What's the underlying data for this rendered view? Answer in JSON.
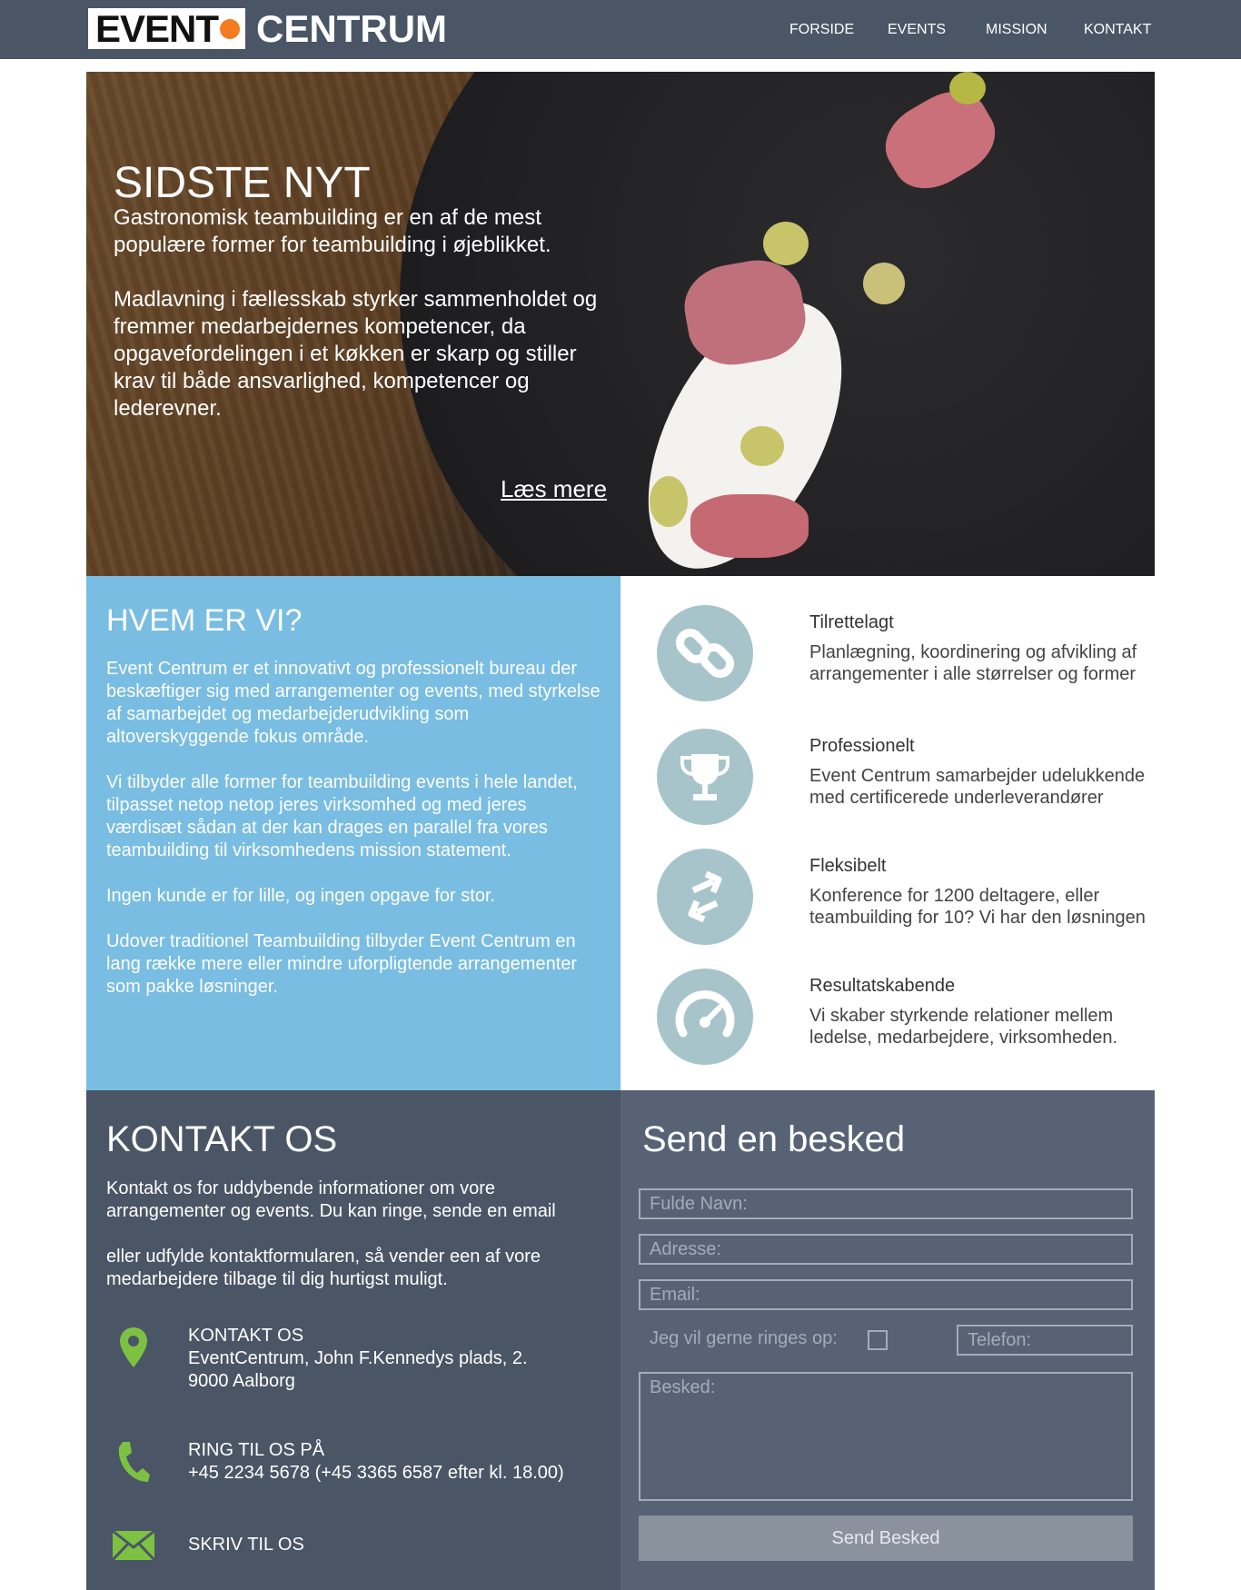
{
  "header": {
    "logo_left": "EVENT",
    "logo_right": "CENTRUM",
    "nav": [
      "FORSIDE",
      "EVENTS",
      "MISSION",
      "KONTAKT"
    ]
  },
  "hero": {
    "title": "SIDSTE NYT",
    "paragraph1": "Gastronomisk teambuilding er en af de mest populære former for teambuilding i øjeblikket.",
    "paragraph2": "Madlavning i fællesskab styrker sammenholdet og fremmer medarbejdernes kompetencer, da opgavefordelingen i et køkken er skarp og stiller krav til både ansvarlighed, kompetencer og lederevner.",
    "read_more": "Læs mere"
  },
  "who": {
    "title": "HVEM ER VI?",
    "paragraphs": [
      "Event Centrum er et innovativt og professionelt bureau der beskæftiger sig med arrangementer og events, med styrkelse af samarbejdet og medarbejderudvikling som altoverskyggende fokus område.",
      "Vi tilbyder alle former for teambuilding events i hele landet, tilpasset netop netop jeres virksomhed og med jeres værdisæt sådan at der kan drages en parallel fra vores teambuilding til virksomhedens mission statement.",
      "Ingen  kunde er for lille, og ingen opgave for stor.",
      "Udover traditionel Teambuilding tilbyder Event Centrum en lang række mere eller mindre uforpligtende arrangementer som pakke løsninger."
    ]
  },
  "features": [
    {
      "title": "Tilrettelagt",
      "text": "Planlægning, koordinering og afvikling af arrangementer i alle størrelser og former",
      "icon": "link-icon"
    },
    {
      "title": "Professionelt",
      "text": "Event Centrum samarbejder udelukkende med certificerede  underleverandører",
      "icon": "trophy-icon"
    },
    {
      "title": "Fleksibelt",
      "text": "Konference for 1200 deltagere, eller teambuilding for 10? Vi har den løsningen",
      "icon": "arrows-icon"
    },
    {
      "title": "Resultatskabende",
      "text": "Vi skaber styrkende relationer mellem ledelse, medarbejdere, virksomheden.",
      "icon": "speedometer-icon"
    }
  ],
  "contact": {
    "title": "KONTAKT OS",
    "paragraph1": "Kontakt os for uddybende informationer om vore arrangementer og events. Du kan ringe, sende en email",
    "paragraph2": "eller udfylde kontaktformularen, så vender een af vore medarbejdere tilbage til dig hurtigst muligt.",
    "address_heading": "KONTAKT OS",
    "address_line1": "EventCentrum, John F.Kennedys plads, 2.",
    "address_line2": "9000 Aalborg",
    "phone_heading": "RING TIL OS PÅ",
    "phone_line": "+45 2234 5678 (+45 3365 6587 efter kl. 18.00)",
    "email_heading": "SKRIV TIL OS",
    "accent_color": "#7dc142"
  },
  "form": {
    "title": "Send en besked",
    "name_placeholder": "Fulde Navn:",
    "address_placeholder": "Adresse:",
    "email_placeholder": "Email:",
    "callback_label": "Jeg vil gerne ringes op:",
    "phone_placeholder": "Telefon:",
    "message_placeholder": "Besked:",
    "submit_label": "Send Besked"
  },
  "colors": {
    "header_bg": "#4a5566",
    "who_bg": "#79bde2",
    "feature_icon_bg": "#a8c4cb",
    "contact_bg": "#4a5566",
    "form_bg": "#576375",
    "logo_dot": "#f47b20"
  }
}
